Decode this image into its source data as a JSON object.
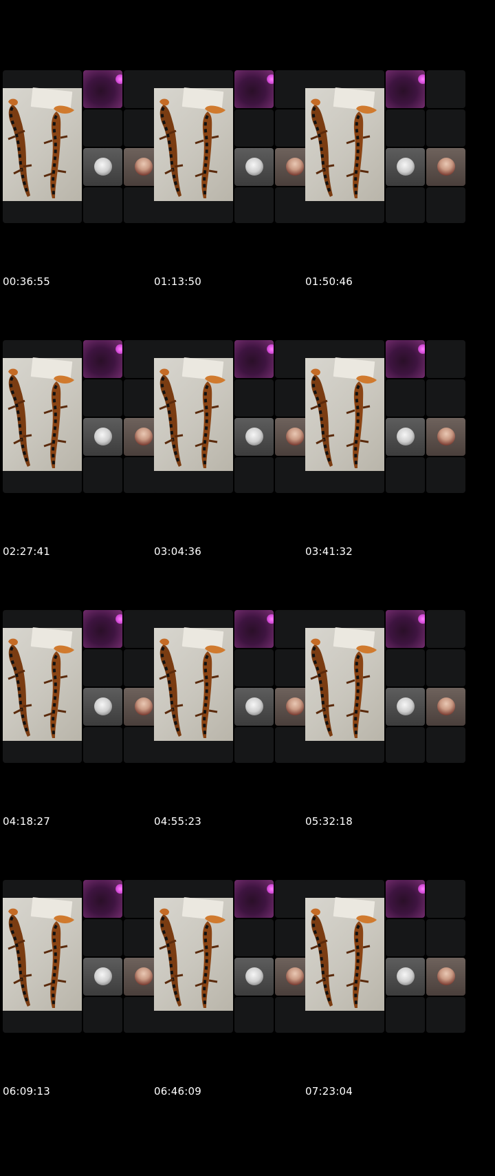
{
  "frames": [
    {
      "timestamp": "00:36:55"
    },
    {
      "timestamp": "01:13:50"
    },
    {
      "timestamp": "01:50:46"
    },
    {
      "timestamp": "02:27:41"
    },
    {
      "timestamp": "03:04:36"
    },
    {
      "timestamp": "03:41:32"
    },
    {
      "timestamp": "04:18:27"
    },
    {
      "timestamp": "04:55:23"
    },
    {
      "timestamp": "05:32:18"
    },
    {
      "timestamp": "06:09:13"
    },
    {
      "timestamp": "06:46:09"
    },
    {
      "timestamp": "07:23:04"
    }
  ],
  "colors": {
    "background": "#000000",
    "tile": "#161718",
    "timestamp_text": "#ffffff",
    "speaker_glow": "#d24ad6"
  },
  "icons": {
    "avatar_1": "coin-avatar-icon",
    "avatar_2": "person-avatar-icon"
  }
}
